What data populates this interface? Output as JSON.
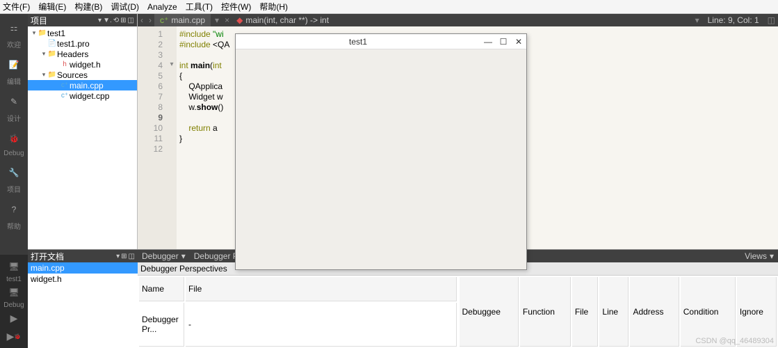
{
  "menu": {
    "file": "文件(F)",
    "edit": "编辑(E)",
    "build": "构建(B)",
    "debug": "调试(D)",
    "analyze": "Analyze",
    "tools": "工具(T)",
    "widgets": "控件(W)",
    "help": "帮助(H)"
  },
  "leftbar": {
    "welcome": "欢迎",
    "edit": "编辑",
    "design": "设计",
    "debug": "Debug",
    "project": "项目",
    "help": "帮助",
    "test": "test1",
    "debug2": "Debug"
  },
  "project": {
    "header": "项目",
    "root": "test1",
    "pro": "test1.pro",
    "headers": "Headers",
    "widget_h": "widget.h",
    "sources": "Sources",
    "main_cpp": "main.cpp",
    "widget_cpp": "widget.cpp"
  },
  "tabs": {
    "file": "main.cpp",
    "crumb": "main(int, char **) -> int"
  },
  "status": {
    "pos": "Line: 9, Col: 1"
  },
  "code": {
    "lines": [
      {
        "n": "1",
        "html": "<span class='kw'>#include</span> <span class='str'>\"wi</span>"
      },
      {
        "n": "2",
        "html": "<span class='kw'>#include</span> &lt;QA"
      },
      {
        "n": "3",
        "html": ""
      },
      {
        "n": "4",
        "html": "<span class='kw'>int</span> <span class='fn'>main</span>(<span class='kw'>int</span>",
        "fold": "▾"
      },
      {
        "n": "5",
        "html": "{"
      },
      {
        "n": "6",
        "html": "    QApplica"
      },
      {
        "n": "7",
        "html": "    Widget w"
      },
      {
        "n": "8",
        "html": "    w.<span class='fn'>show</span>()"
      },
      {
        "n": "9",
        "html": "",
        "cur": true
      },
      {
        "n": "10",
        "html": "    <span class='kw'>return</span> a"
      },
      {
        "n": "11",
        "html": "}"
      },
      {
        "n": "12",
        "html": ""
      }
    ]
  },
  "openfiles": {
    "header": "打开文档",
    "items": [
      "main.cpp",
      "widget.h"
    ]
  },
  "debugger": {
    "tab1": "Debugger",
    "tab2": "Debugger Preset",
    "views": "Views",
    "persp": "Debugger Perspectives",
    "left_cols": [
      "Name",
      "File"
    ],
    "left_row": [
      "Debugger Pr...",
      "-"
    ],
    "right_cols": [
      "Debuggee",
      "Function",
      "File",
      "Line",
      "Address",
      "Condition",
      "Ignore"
    ]
  },
  "appwin": {
    "title": "test1"
  },
  "watermark": "CSDN @qq_46489304",
  "chart_data": null
}
